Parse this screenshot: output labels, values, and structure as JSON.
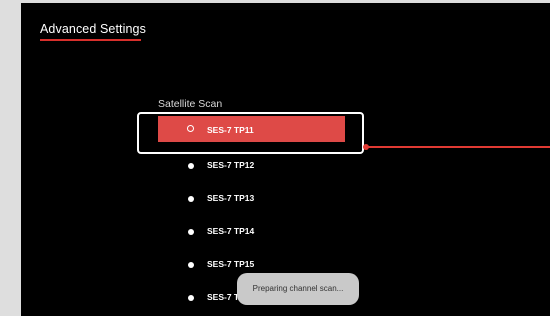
{
  "page": {
    "title": "Advanced Settings"
  },
  "section": {
    "heading": "Satellite Scan"
  },
  "satellites": [
    {
      "label": "SES-7 TP11",
      "selected": true
    },
    {
      "label": "SES-7 TP12",
      "selected": false
    },
    {
      "label": "SES-7 TP13",
      "selected": false
    },
    {
      "label": "SES-7 TP14",
      "selected": false
    },
    {
      "label": "SES-7 TP15",
      "selected": false
    },
    {
      "label": "SES-7 TP16",
      "selected": false
    }
  ],
  "toast": {
    "message": "Preparing channel scan..."
  },
  "colors": {
    "accent": "#de4a47",
    "underline": "#d8302c",
    "background": "#000000",
    "toast_bg": "#c9c9c9"
  },
  "icons": {
    "list_bullet": "radio-dot-icon"
  }
}
